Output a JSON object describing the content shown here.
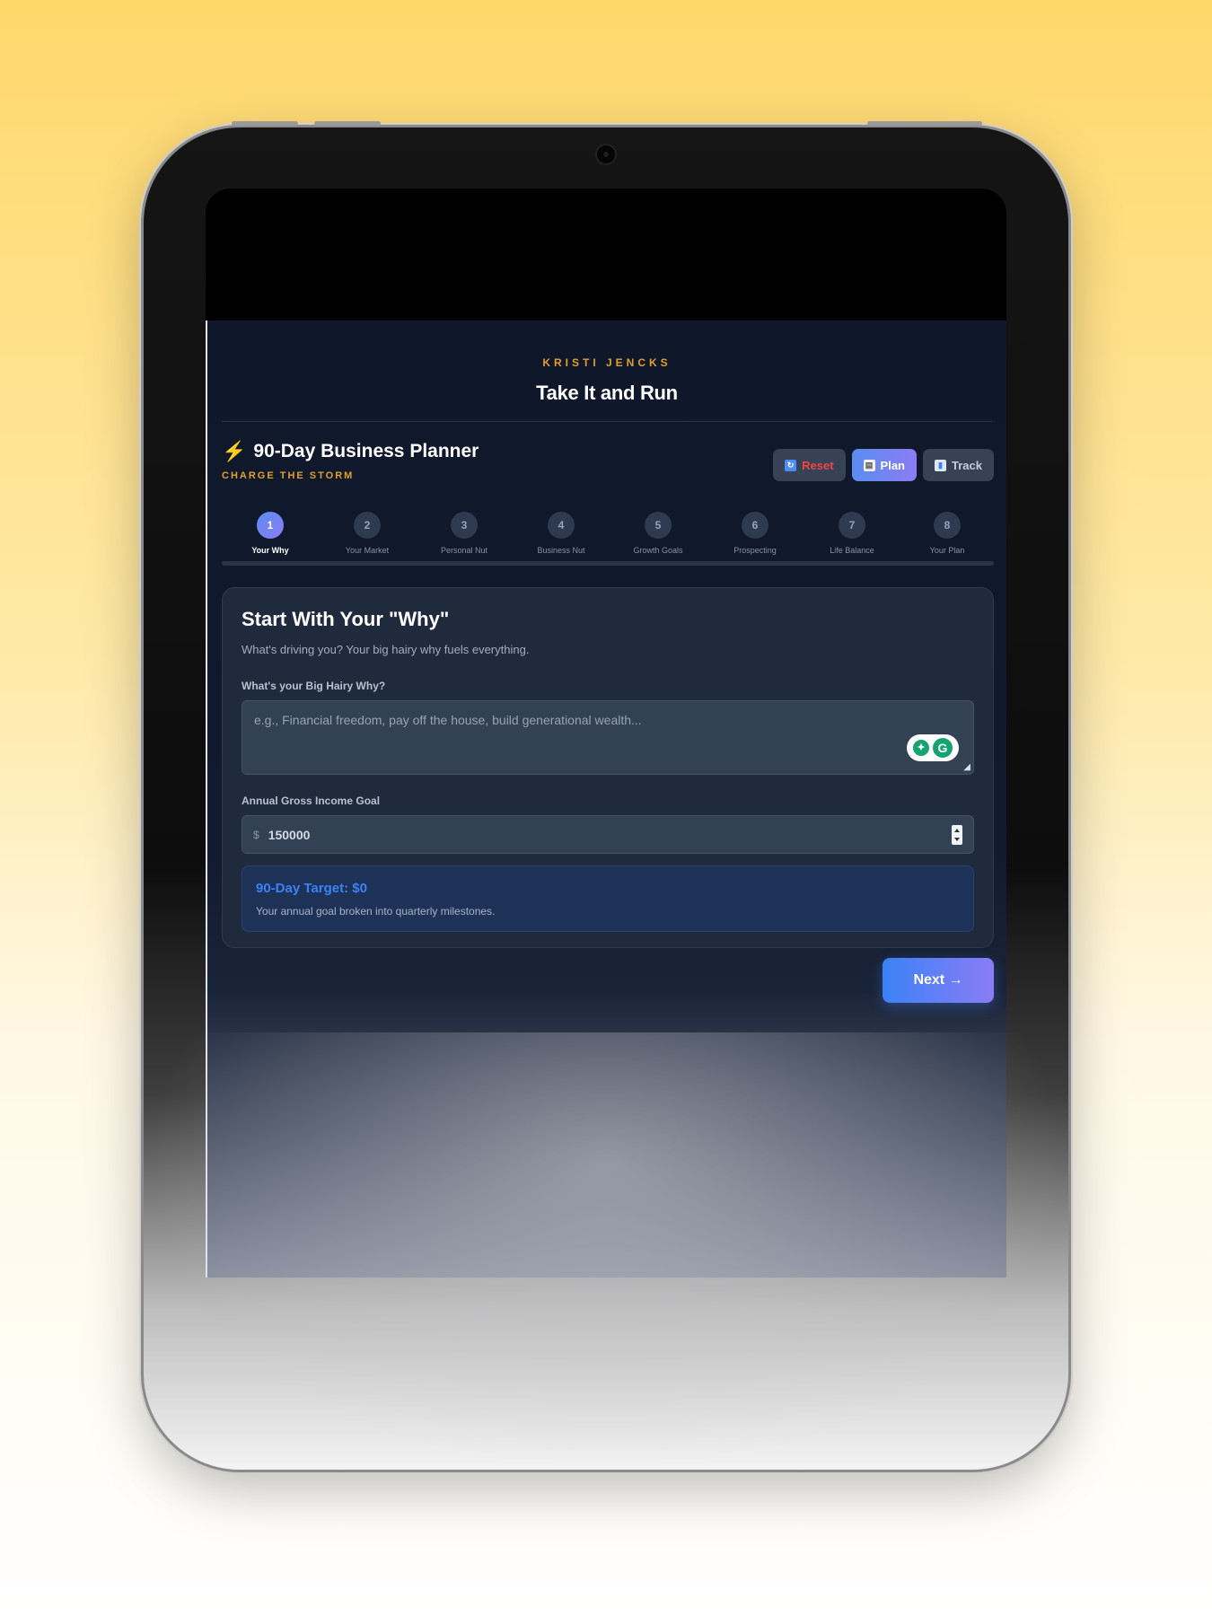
{
  "brand": {
    "name": "KRISTI JENCKS",
    "title": "Take It and Run"
  },
  "planner": {
    "icon": "lightning-icon",
    "title": "90-Day Business Planner",
    "subtitle": "CHARGE THE STORM"
  },
  "actions": {
    "reset_label": "Reset",
    "plan_label": "Plan",
    "track_label": "Track",
    "reset_color": "#ef4444"
  },
  "steps": [
    {
      "num": "1",
      "label": "Your Why",
      "active": true
    },
    {
      "num": "2",
      "label": "Your Market"
    },
    {
      "num": "3",
      "label": "Personal Nut"
    },
    {
      "num": "4",
      "label": "Business Nut"
    },
    {
      "num": "5",
      "label": "Growth Goals"
    },
    {
      "num": "6",
      "label": "Prospecting"
    },
    {
      "num": "7",
      "label": "Life Balance"
    },
    {
      "num": "8",
      "label": "Your Plan"
    }
  ],
  "card": {
    "title": "Start With Your \"Why\"",
    "description": "What's driving you? Your big hairy why fuels everything.",
    "why_label": "What's your Big Hairy Why?",
    "why_placeholder": "e.g., Financial freedom, pay off the house, build generational wealth...",
    "income_label": "Annual Gross Income Goal",
    "currency": "$",
    "income_value": "150000",
    "target_title": "90-Day Target: $0",
    "target_desc": "Your annual goal broken into quarterly milestones."
  },
  "next_label": "Next →",
  "colors": {
    "accent": "#5b8def",
    "brand_gold": "#e0a02d",
    "target_blue": "#3b82f6"
  }
}
